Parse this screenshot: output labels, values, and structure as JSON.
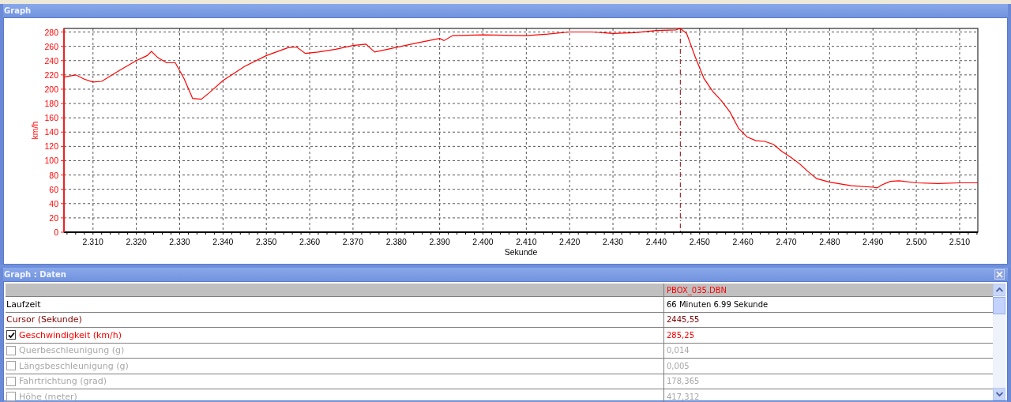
{
  "graph_panel": {
    "title": "Graph",
    "chart_data": {
      "type": "line",
      "xlabel": "Sekunde",
      "ylabel": "km/h",
      "xlim": [
        2303.3,
        2514.2
      ],
      "ylim": [
        0,
        285
      ],
      "xticks": [
        {
          "value": 2310,
          "label": "2.310"
        },
        {
          "value": 2320,
          "label": "2.320"
        },
        {
          "value": 2330,
          "label": "2.330"
        },
        {
          "value": 2340,
          "label": "2.340"
        },
        {
          "value": 2350,
          "label": "2.350"
        },
        {
          "value": 2360,
          "label": "2.360"
        },
        {
          "value": 2370,
          "label": "2.370"
        },
        {
          "value": 2380,
          "label": "2.380"
        },
        {
          "value": 2390,
          "label": "2.390"
        },
        {
          "value": 2400,
          "label": "2.400"
        },
        {
          "value": 2410,
          "label": "2.410"
        },
        {
          "value": 2420,
          "label": "2.420"
        },
        {
          "value": 2430,
          "label": "2.430"
        },
        {
          "value": 2440,
          "label": "2.440"
        },
        {
          "value": 2450,
          "label": "2.450"
        },
        {
          "value": 2460,
          "label": "2.460"
        },
        {
          "value": 2470,
          "label": "2.470"
        },
        {
          "value": 2480,
          "label": "2.480"
        },
        {
          "value": 2490,
          "label": "2.490"
        },
        {
          "value": 2500,
          "label": "2.500"
        },
        {
          "value": 2510,
          "label": "2.510"
        }
      ],
      "yticks": [
        0,
        20,
        40,
        60,
        80,
        100,
        120,
        140,
        160,
        180,
        200,
        220,
        240,
        260,
        280
      ],
      "x": [
        2303.3,
        2306,
        2308,
        2310,
        2312,
        2316,
        2320,
        2322.5,
        2323.5,
        2325,
        2327,
        2329,
        2331,
        2333,
        2335,
        2337,
        2340,
        2345,
        2350,
        2355,
        2357,
        2359,
        2362,
        2366,
        2370,
        2373,
        2375,
        2378,
        2385,
        2390,
        2391,
        2393,
        2400,
        2410,
        2415,
        2420,
        2425,
        2430,
        2435,
        2440,
        2444.5,
        2445.5,
        2447,
        2449,
        2451,
        2453,
        2455,
        2457,
        2459,
        2461,
        2463,
        2465,
        2467,
        2469,
        2471,
        2473,
        2475,
        2477,
        2480,
        2485,
        2490,
        2491,
        2492,
        2494,
        2496,
        2500,
        2505,
        2510,
        2514.2
      ],
      "series": [
        {
          "color": "#ff0000",
          "values": [
            217,
            220,
            214,
            210,
            211,
            226,
            240,
            247,
            253,
            244,
            237,
            237,
            215,
            187,
            186,
            196,
            212,
            232,
            247,
            258,
            259,
            250,
            252,
            256,
            261,
            263,
            252,
            256,
            265,
            271,
            268,
            275,
            276,
            275,
            277,
            280,
            280,
            278,
            279,
            282,
            283,
            285,
            278,
            245,
            215,
            197,
            184,
            168,
            145,
            133,
            128,
            127,
            123,
            113,
            105,
            96,
            85,
            75,
            70,
            65,
            63,
            62,
            66,
            71,
            72,
            69,
            68,
            69,
            69
          ]
        }
      ],
      "grid": true,
      "ref_lines": [
        {
          "axis": "x",
          "value": 2445.55
        }
      ]
    }
  },
  "data_panel": {
    "title": "Graph : Daten",
    "table": {
      "columns": [
        {
          "label": "PBOX_035.DBN",
          "color": "#ff0000"
        }
      ],
      "rows": [
        {
          "kind": "info",
          "label": "Laufzeit",
          "value": "66 Minuten 6.99 Sekunde",
          "color": "#000000"
        },
        {
          "kind": "info",
          "label": "Cursor (Sekunde)",
          "value": "2445,55",
          "color": "#800000"
        },
        {
          "kind": "channel",
          "label": "Geschwindigkeit (km/h)",
          "value": "285,25",
          "checked": true,
          "color": "#ff0000"
        },
        {
          "kind": "channel",
          "label": "Querbeschleunigung (g)",
          "value": "0,014",
          "checked": false,
          "color": "#a8a8a8"
        },
        {
          "kind": "channel",
          "label": "Längsbeschleunigung (g)",
          "value": "0,005",
          "checked": false,
          "color": "#a8a8a8"
        },
        {
          "kind": "channel",
          "label": "Fahrtrichtung (grad)",
          "value": "178,365",
          "checked": false,
          "color": "#a8a8a8"
        },
        {
          "kind": "channel",
          "label": "Höhe (meter)",
          "value": "417,312",
          "checked": false,
          "color": "#a8a8a8"
        }
      ]
    }
  }
}
